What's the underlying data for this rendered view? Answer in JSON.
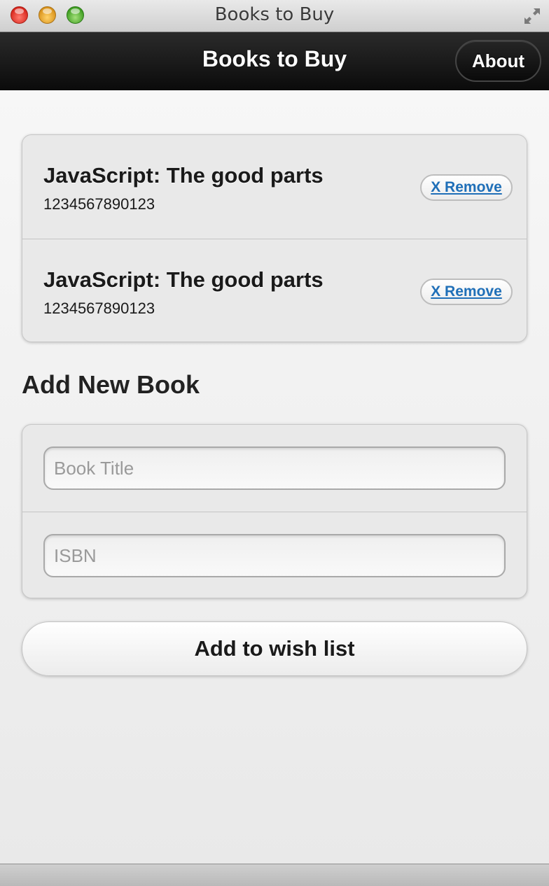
{
  "window": {
    "title": "Books to Buy",
    "controls": [
      "close",
      "minimize",
      "zoom"
    ],
    "fullscreen_icon": "fullscreen-arrows-icon"
  },
  "header": {
    "title": "Books to Buy",
    "about_label": "About"
  },
  "books": [
    {
      "title": "JavaScript: The good parts",
      "isbn": "1234567890123",
      "remove_label": "X Remove"
    },
    {
      "title": "JavaScript: The good parts",
      "isbn": "1234567890123",
      "remove_label": "X Remove"
    }
  ],
  "add_form": {
    "heading": "Add New Book",
    "title_field": {
      "value": "",
      "placeholder": "Book Title"
    },
    "isbn_field": {
      "value": "",
      "placeholder": "ISBN"
    },
    "submit_label": "Add to wish list"
  },
  "colors": {
    "header_bg": "#111111",
    "link": "#1f6fb8",
    "background": "#ededed"
  }
}
